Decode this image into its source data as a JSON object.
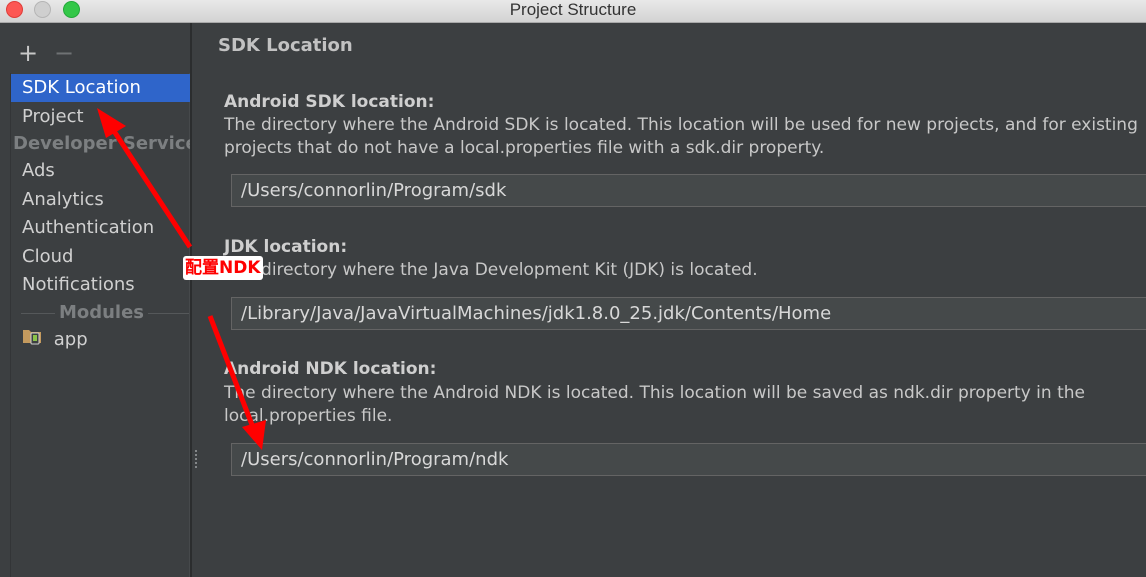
{
  "window": {
    "title": "Project Structure",
    "controls": [
      "close",
      "minimize",
      "maximize"
    ]
  },
  "toolbar": {
    "add_label": "+",
    "remove_label": "−"
  },
  "sidebar": {
    "items": [
      {
        "label": "SDK Location",
        "selected": true
      },
      {
        "label": "Project"
      }
    ],
    "developer_services_header": "Developer Services",
    "developer_services": [
      {
        "label": "Ads"
      },
      {
        "label": "Analytics"
      },
      {
        "label": "Authentication"
      },
      {
        "label": "Cloud"
      },
      {
        "label": "Notifications"
      }
    ],
    "modules_header": "Modules",
    "modules": [
      {
        "label": "app",
        "icon": "android-module-folder-icon"
      }
    ]
  },
  "content": {
    "title": "SDK Location",
    "sdk": {
      "label": "Android SDK location:",
      "desc_line1": "The directory where the Android SDK is located. This location will be used for new projects, and for existing",
      "desc_line2": "projects that do not have a local.properties file with a sdk.dir property.",
      "value": "/Users/connorlin/Program/sdk"
    },
    "jdk": {
      "label": "JDK location:",
      "desc_line1": "The directory where the Java Development Kit (JDK) is located.",
      "value": "/Library/Java/JavaVirtualMachines/jdk1.8.0_25.jdk/Contents/Home"
    },
    "ndk": {
      "label": "Android NDK location:",
      "desc_line1": "The directory where the Android NDK is located. This location will be saved as ndk.dir property in the",
      "desc_line2": "local.properties file.",
      "value": "/Users/connorlin/Program/ndk"
    }
  },
  "annotation": {
    "label": "配置NDK",
    "color": "#ff0000"
  },
  "colors": {
    "selection": "#2f65ca",
    "background": "#3c3f41",
    "input_background": "#45494a"
  }
}
